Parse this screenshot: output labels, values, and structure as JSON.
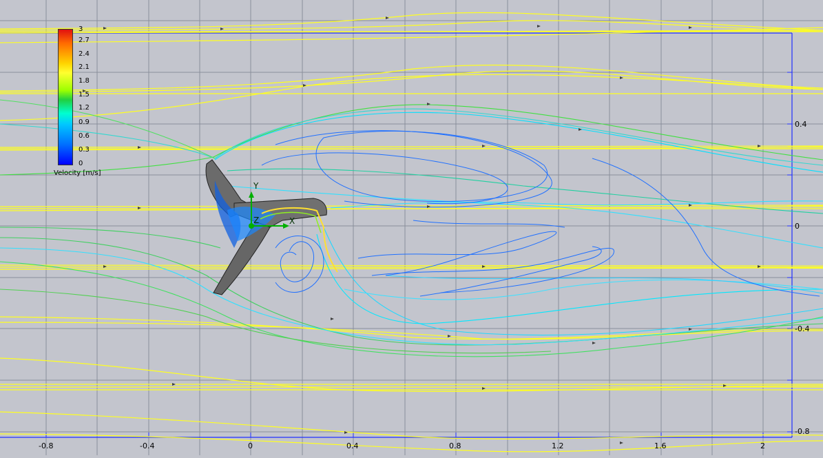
{
  "legend": {
    "title": "Velocity [m/s]",
    "ticks": [
      "3",
      "2.7",
      "2.4",
      "2.1",
      "1.8",
      "1.5",
      "1.2",
      "0.9",
      "0.6",
      "0.3",
      "0"
    ]
  },
  "axes": {
    "x_ticks": [
      "-0.8",
      "-0.4",
      "0",
      "0.4",
      "0.8",
      "1.2",
      "1.6",
      "2"
    ],
    "y_ticks": [
      "0.4",
      "0",
      "-0.4",
      "-0.8"
    ]
  },
  "triad": {
    "x": "X",
    "y": "Y",
    "z": "Z"
  }
}
